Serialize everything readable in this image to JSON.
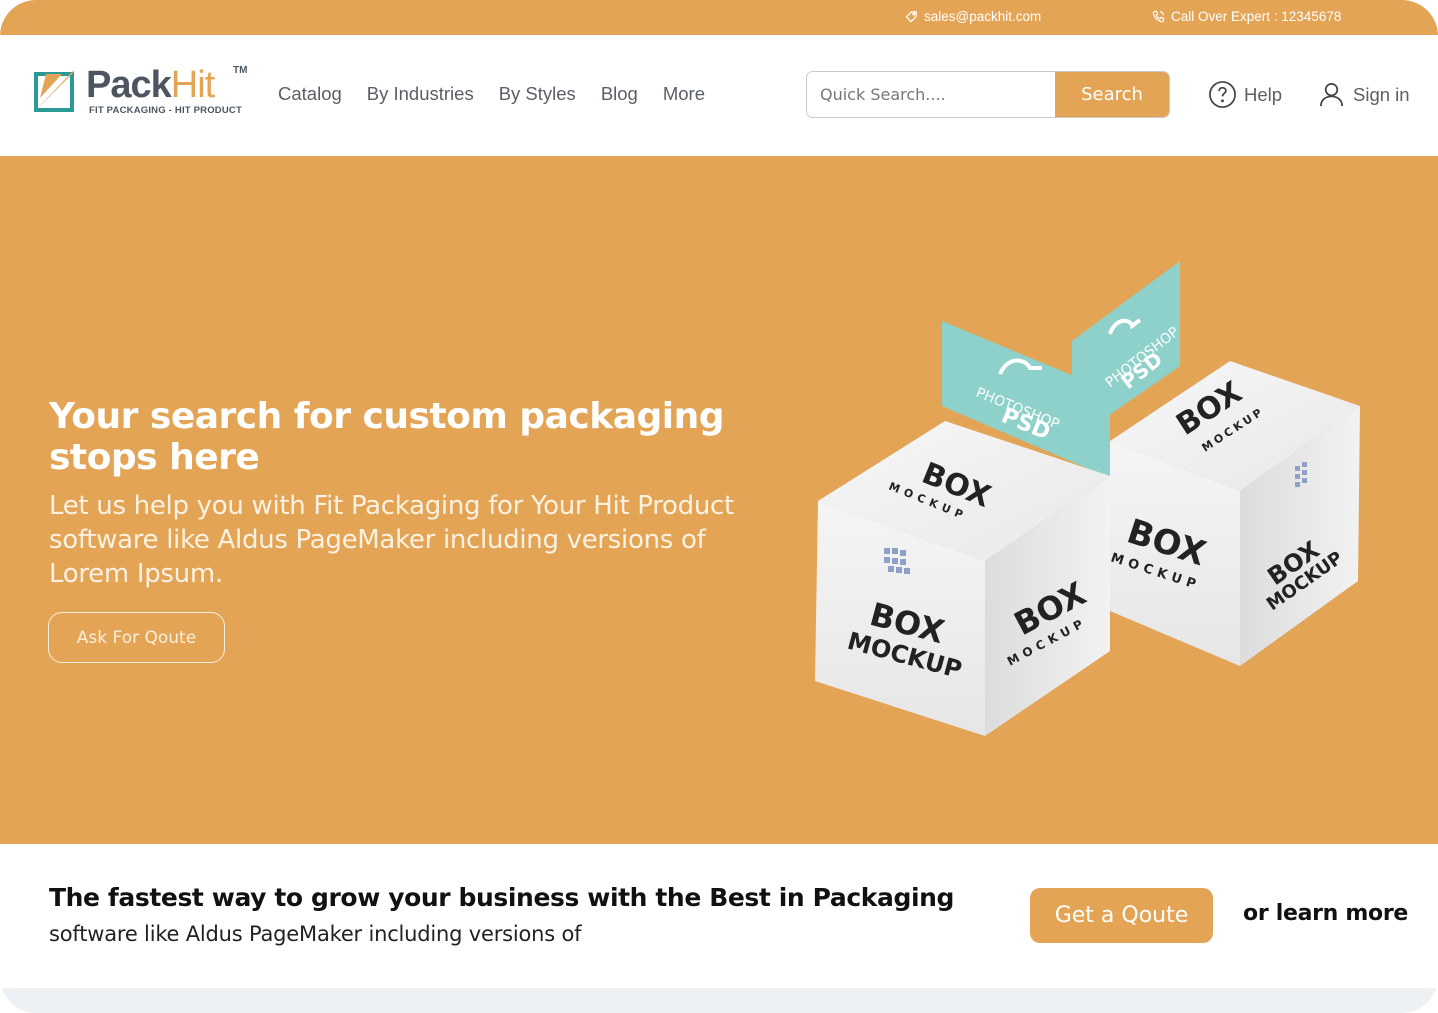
{
  "topbar": {
    "email": "sales@packhit.com",
    "phone": "Call Over Expert : 12345678",
    "email_icon": "tag-icon",
    "phone_icon": "phone-icon"
  },
  "logo": {
    "pack": "Pack",
    "hit": "Hit",
    "tm": "TM",
    "tagline": "FIT PACKAGING - HIT PRODUCT"
  },
  "nav": {
    "items": [
      "Catalog",
      "By Industries",
      "By Styles",
      "Blog",
      "More"
    ]
  },
  "search": {
    "placeholder": "Quick Search....",
    "button": "Search"
  },
  "help": {
    "label": "Help",
    "icon": "question-circle-icon"
  },
  "signin": {
    "label": "Sign in",
    "icon": "user-icon"
  },
  "hero": {
    "title": "Your search for custom packaging stops here",
    "text": "Let us help you with Fit Packaging for Your Hit Product software like Aldus PageMaker including versions of Lorem Ipsum.",
    "button": "Ask For Qoute",
    "box_text": {
      "box": "BOX",
      "mockup": "MOCKUP",
      "tab_top": "PHOTOSHOP",
      "tab_bottom": "PSD"
    }
  },
  "promo": {
    "title": "The fastest way to grow  your business with the Best in Packaging",
    "subtitle": "software like Aldus PageMaker including versions of",
    "button": "Get a Qoute",
    "learn": "or learn more"
  },
  "colors": {
    "accent": "#E3A456",
    "tab": "#8ED1CA",
    "text_dark": "#111111",
    "nav_text": "#5A5F66"
  }
}
